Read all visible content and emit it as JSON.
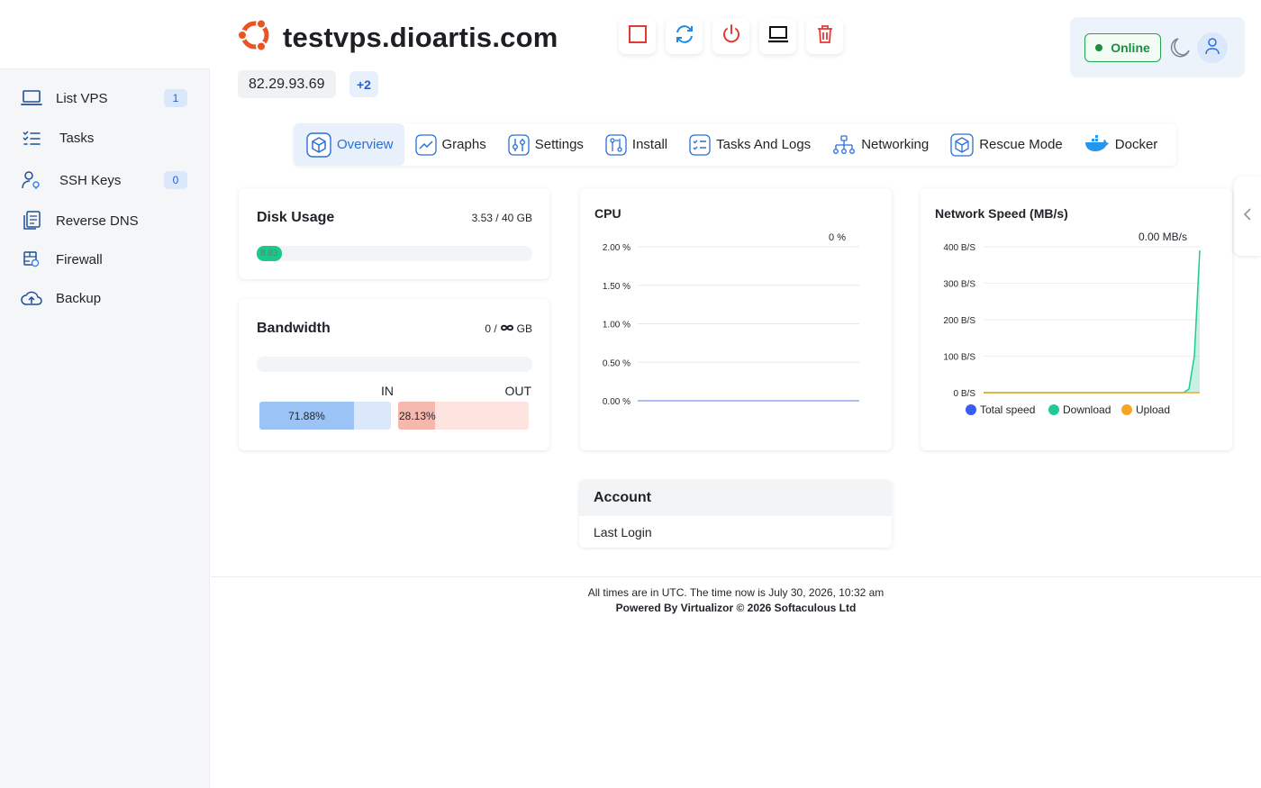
{
  "header": {
    "hostname": "testvps.dioartis.com",
    "ip": "82.29.93.69",
    "ip_more": "+2",
    "status": "Online"
  },
  "sidebar": {
    "items": [
      {
        "label": "List VPS",
        "badge": "1",
        "icon": "laptop-icon"
      },
      {
        "label": "Tasks",
        "badge": "",
        "icon": "tasks-list-icon"
      },
      {
        "label": "SSH Keys",
        "badge": "0",
        "icon": "ssh-key-user-icon"
      },
      {
        "label": "Reverse DNS",
        "badge": "",
        "icon": "reverse-dns-icon"
      },
      {
        "label": "Firewall",
        "badge": "",
        "icon": "firewall-icon"
      },
      {
        "label": "Backup",
        "badge": "",
        "icon": "cloud-upload-icon"
      }
    ]
  },
  "tabs": [
    {
      "label": "Overview",
      "active": true,
      "icon": "cube-icon"
    },
    {
      "label": "Graphs",
      "icon": "graph-icon"
    },
    {
      "label": "Settings",
      "icon": "sliders-icon"
    },
    {
      "label": "Install",
      "icon": "install-icon"
    },
    {
      "label": "Tasks And Logs",
      "icon": "tasks-logs-icon"
    },
    {
      "label": "Networking",
      "icon": "network-icon"
    },
    {
      "label": "Rescue Mode",
      "icon": "rescue-icon"
    },
    {
      "label": "Docker",
      "icon": "docker-icon"
    }
  ],
  "disk": {
    "title": "Disk Usage",
    "value": "3.53 / 40 GB",
    "percent_label": "8.83",
    "percent": 8.83
  },
  "bandwidth": {
    "title": "Bandwidth",
    "value_prefix": "0 /",
    "value_unit": "GB",
    "in_label": "IN",
    "out_label": "OUT",
    "in_percent_label": "71.88%",
    "in_percent": 71.88,
    "out_percent_label": "28.13%",
    "out_percent": 28.13
  },
  "cpu_title": "CPU",
  "net_title": "Network Speed (MB/s)",
  "account": {
    "title": "Account",
    "last_login_label": "Last Login"
  },
  "footer": {
    "line1": "All times are in UTC. The time now is July 30, 2026, 10:32 am",
    "line2": "Powered By Virtualizor © 2026 Softaculous Ltd"
  },
  "colors": {
    "accent": "#2a6fd6",
    "online": "#1a8f3f",
    "disk_fill": "#1cc88a",
    "in_fill": "#9cc3f5",
    "out_fill": "#f6b7ac",
    "total_speed": "#3b5bf5",
    "download": "#20c997",
    "upload": "#f5a524"
  },
  "chart_data": [
    {
      "type": "line",
      "title": "CPU",
      "current_label": "0 %",
      "y_ticks": [
        "2.00 %",
        "1.50 %",
        "1.00 %",
        "0.50 %",
        "0.00 %"
      ],
      "ylim": [
        0,
        2
      ],
      "series": [
        {
          "values": [
            0,
            0,
            0,
            0,
            0,
            0,
            0,
            0,
            0,
            0
          ]
        }
      ]
    },
    {
      "type": "area",
      "title": "Network Speed (MB/s)",
      "current_label": "0.00 MB/s",
      "y_ticks": [
        "400 B/S",
        "300 B/S",
        "200 B/S",
        "100 B/S",
        "0 B/S"
      ],
      "ylim": [
        0,
        400
      ],
      "legend": [
        "Total speed",
        "Download",
        "Upload"
      ],
      "series": [
        {
          "name": "Download",
          "values": [
            0,
            0,
            0,
            0,
            0,
            0,
            0,
            0,
            0,
            0,
            0,
            0,
            0,
            0,
            0,
            0,
            0,
            0,
            0,
            0,
            0,
            0,
            0,
            0,
            0,
            0,
            0,
            0,
            0,
            0,
            0,
            0,
            0,
            0,
            0,
            0,
            0,
            0,
            10,
            100,
            390
          ]
        },
        {
          "name": "Upload",
          "values": [
            0,
            0,
            0,
            0,
            0,
            0,
            0,
            0,
            0,
            0,
            0,
            0,
            0,
            0,
            0,
            0,
            0,
            0,
            0,
            0,
            0,
            0,
            0,
            0,
            0,
            0,
            0,
            0,
            0,
            0,
            0,
            0,
            0,
            0,
            0,
            0,
            0,
            0,
            0,
            0,
            0
          ]
        }
      ]
    }
  ]
}
